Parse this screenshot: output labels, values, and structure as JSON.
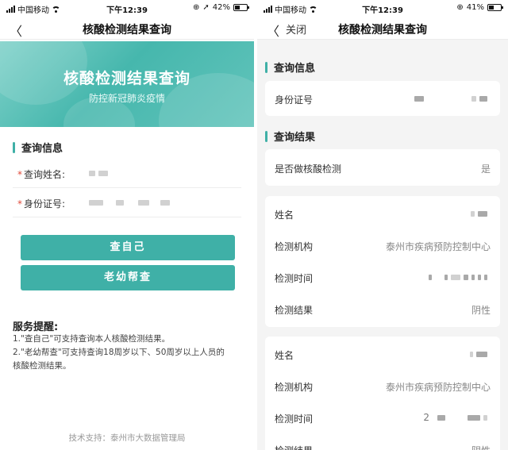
{
  "status_left": {
    "carrier": "中国移动",
    "time": "下午12:39",
    "battery": "42%",
    "battery_level": 0.42
  },
  "status_right": {
    "carrier": "中国移动",
    "time": "下午12:39",
    "battery": "41%",
    "battery_level": 0.41
  },
  "left": {
    "nav_title": "核酸检测结果查询",
    "banner_title": "核酸检测结果查询",
    "banner_subtitle": "防控新冠肺炎疫情",
    "section_title": "查询信息",
    "name_label": "查询姓名:",
    "id_label": "身份证号:",
    "required_mark": "*",
    "btn_self": "查自己",
    "btn_family": "老幼帮查",
    "notice_title": "服务提醒:",
    "notice_1": "1.\"查自己\"可支持查询本人核酸检测结果。",
    "notice_2": "2.\"老幼帮查\"可支持查询18周岁以下、50周岁以上人员的",
    "notice_3": "核酸检测结果。",
    "footer": "技术支持：泰州市大数据管理局"
  },
  "right": {
    "nav_close": "关闭",
    "nav_title": "核酸检测结果查询",
    "section_query": "查询信息",
    "id_label": "身份证号",
    "section_result": "查询结果",
    "tested_label": "是否做核酸检测",
    "tested_value": "是",
    "record1": {
      "name_label": "姓名",
      "org_label": "检测机构",
      "org_value": "泰州市疾病预防控制中心",
      "time_label": "检测时间",
      "result_label": "检测结果",
      "result_value": "阴性"
    },
    "record2": {
      "name_label": "姓名",
      "org_label": "检测机构",
      "org_value": "泰州市疾病预防控制中心",
      "time_label": "检测时间",
      "time_prefix": "2",
      "result_label": "检测结果",
      "result_value": "阴性"
    }
  }
}
